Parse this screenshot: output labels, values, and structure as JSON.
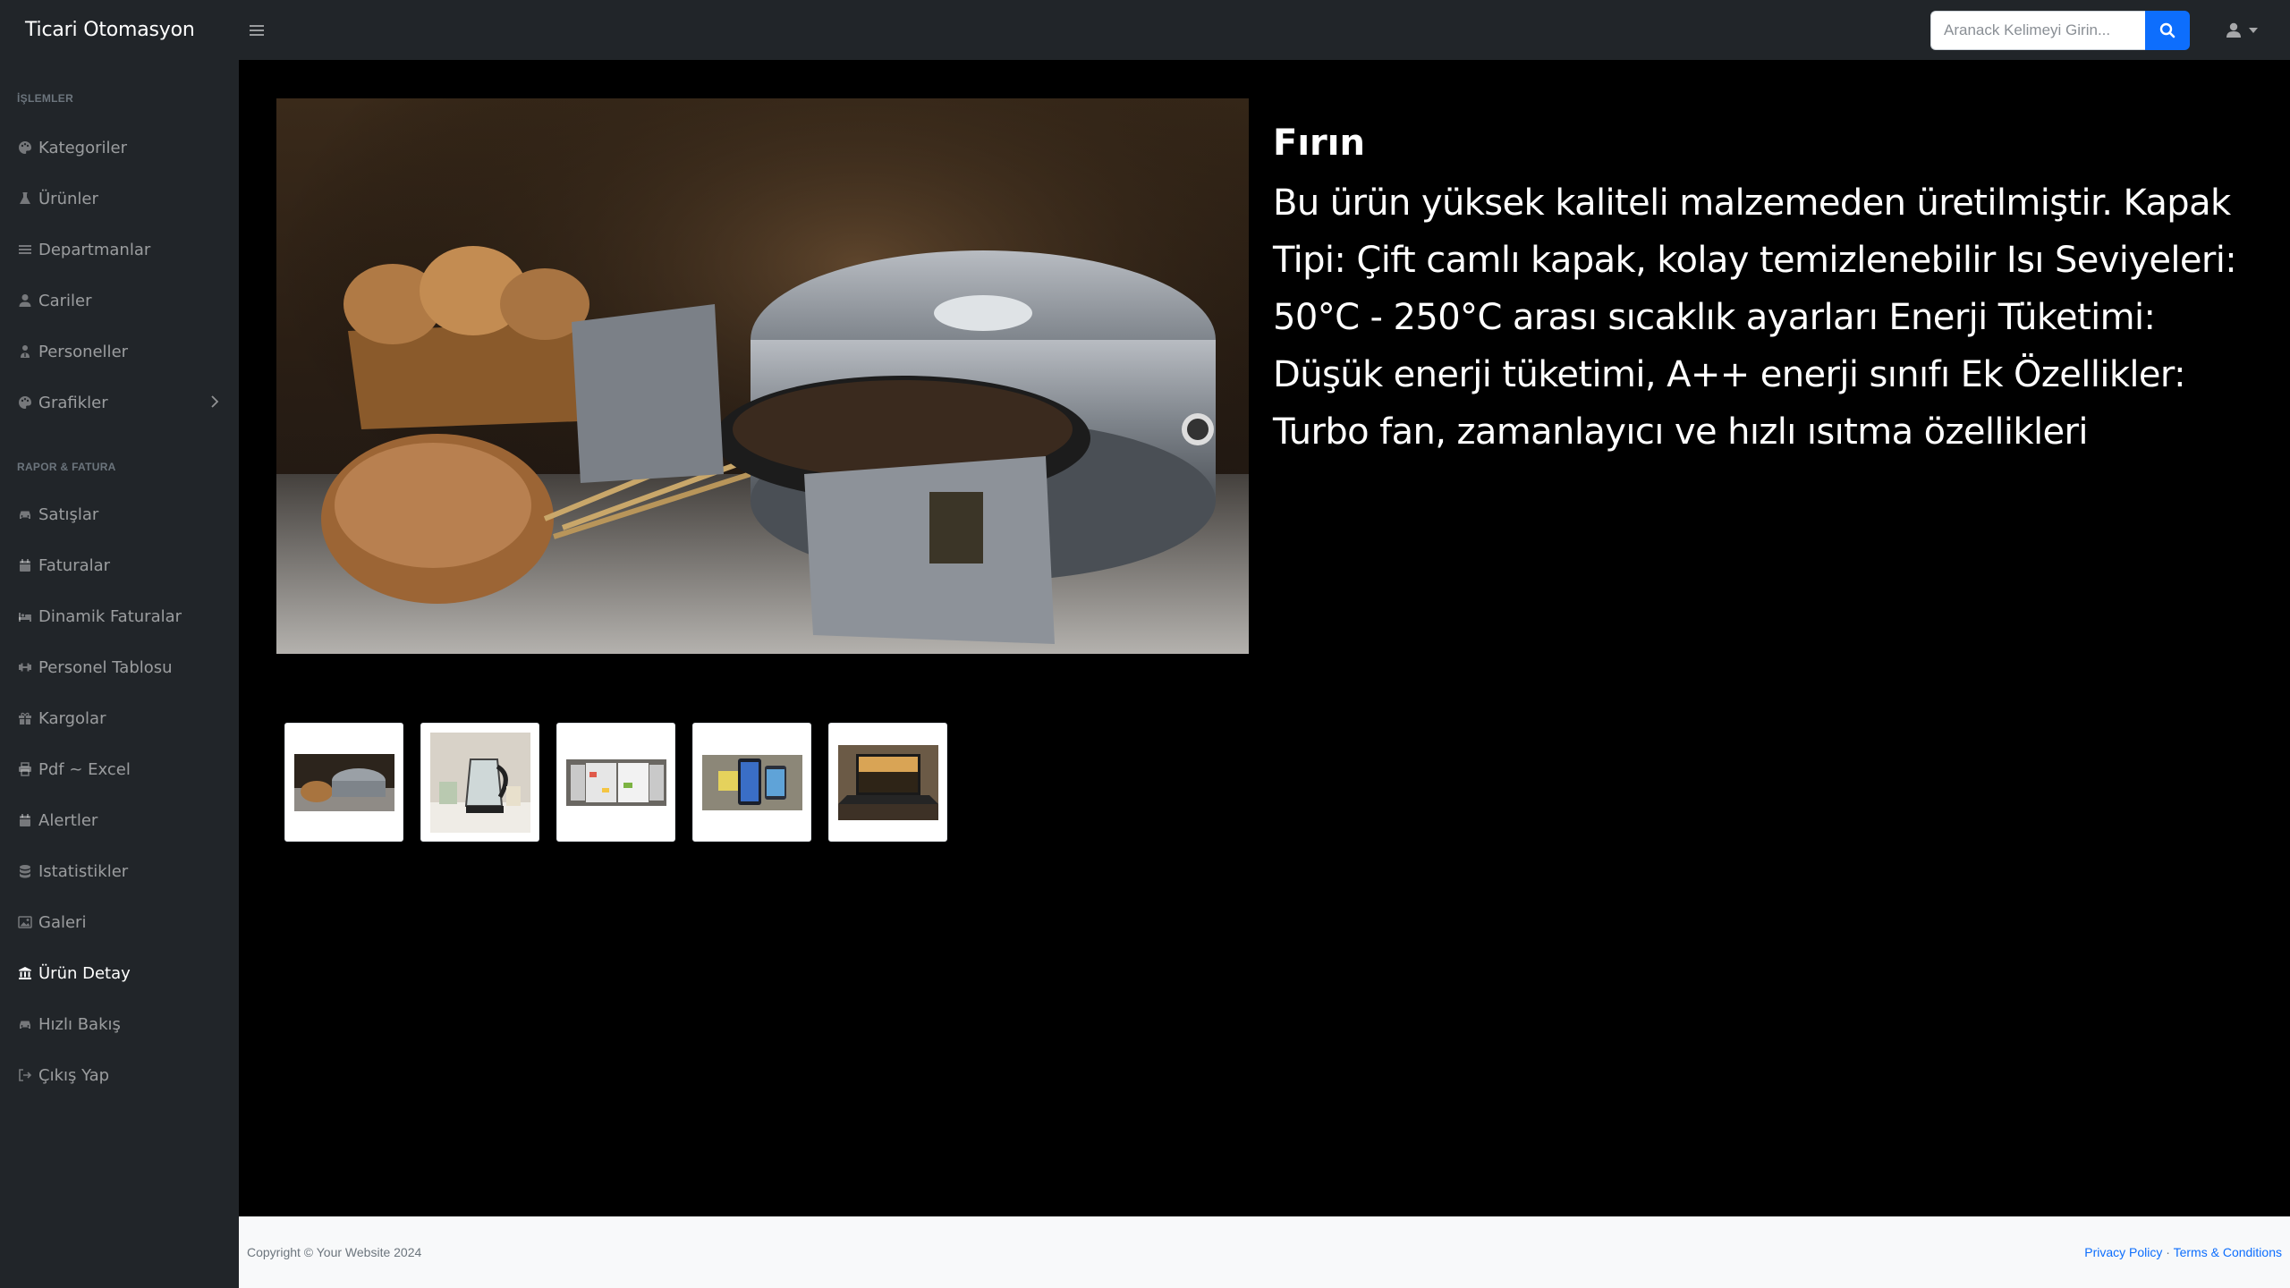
{
  "navbar": {
    "brand": "Ticari Otomasyon",
    "search_placeholder": "Aranack Kelimeyi Girin..."
  },
  "sidebar": {
    "headings": [
      "İşlemler",
      "Rapor & Fatura"
    ],
    "items": [
      {
        "label": "Kategoriler",
        "icon": "palette-icon"
      },
      {
        "label": "Ürünler",
        "icon": "flask-icon"
      },
      {
        "label": "Departmanlar",
        "icon": "bars-icon"
      },
      {
        "label": "Cariler",
        "icon": "user-icon"
      },
      {
        "label": "Personeller",
        "icon": "user-doctor-icon"
      },
      {
        "label": "Grafikler",
        "icon": "palette-icon"
      },
      {
        "label": "Satışlar",
        "icon": "car-icon"
      },
      {
        "label": "Faturalar",
        "icon": "calendar-icon"
      },
      {
        "label": "Dinamik Faturalar",
        "icon": "bed-icon"
      },
      {
        "label": "Personel Tablosu",
        "icon": "dumbbell-icon"
      },
      {
        "label": "Kargolar",
        "icon": "gift-icon"
      },
      {
        "label": "Pdf ~ Excel",
        "icon": "print-icon"
      },
      {
        "label": "Alertler",
        "icon": "calendar-icon"
      },
      {
        "label": "Istatistikler",
        "icon": "database-icon"
      },
      {
        "label": "Galeri",
        "icon": "image-icon"
      },
      {
        "label": "Ürün Detay",
        "icon": "bank-icon"
      },
      {
        "label": "Hızlı Bakış",
        "icon": "car-icon"
      },
      {
        "label": "Çıkış Yap",
        "icon": "sign-out-icon"
      }
    ]
  },
  "product": {
    "title": "Fırın",
    "description": "Bu ürün yüksek kaliteli malzemeden üretilmiştir. Kapak Tipi: Çift camlı kapak, kolay temizlenebilir Isı Seviyeleri: 50°C - 250°C arası sıcaklık ayarları Enerji Tüketimi: Düşük enerji tüketimi, A++ enerji sınıfı Ek Özellikler: Turbo fan, zamanlayıcı ve hızlı ısıtma özellikleri"
  },
  "thumbnails": [
    {
      "label": "oven"
    },
    {
      "label": "kettle"
    },
    {
      "label": "refrigerator"
    },
    {
      "label": "phone"
    },
    {
      "label": "laptop"
    }
  ],
  "footer": {
    "copyright": "Copyright © Your Website 2024",
    "privacy": "Privacy Policy",
    "separator": "·",
    "terms": "Terms & Conditions"
  }
}
